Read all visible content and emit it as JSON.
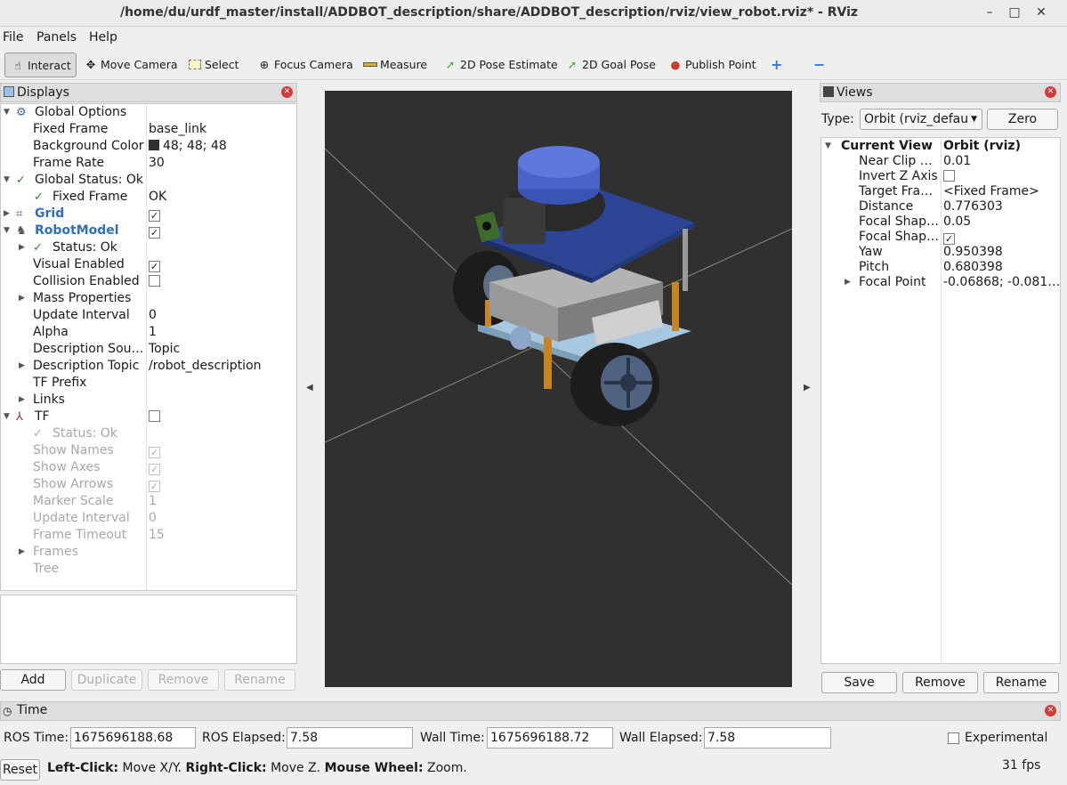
{
  "window": {
    "title": "/home/du/urdf_master/install/ADDBOT_description/share/ADDBOT_description/rviz/view_robot.rviz* - RViz",
    "minimize": "–",
    "maximize": "□",
    "close": "✕"
  },
  "menu": [
    {
      "label": "File",
      "accel": "F"
    },
    {
      "label": "Panels",
      "accel": "P"
    },
    {
      "label": "Help",
      "accel": "H"
    }
  ],
  "menu_labels": {
    "file": "File",
    "panels": "Panels",
    "help": "Help"
  },
  "toolbar": {
    "interact": "Interact",
    "move_camera": "Move Camera",
    "select": "Select",
    "focus_camera": "Focus Camera",
    "measure": "Measure",
    "pose_estimate": "2D Pose Estimate",
    "goal_pose": "2D Goal Pose",
    "publish_point": "Publish Point",
    "add_tool": "+",
    "remove_tool": "−"
  },
  "displays": {
    "title": "Displays",
    "global_options": {
      "label": "Global Options"
    },
    "fixed_frame": {
      "label": "Fixed Frame",
      "value": "base_link"
    },
    "background_color": {
      "label": "Background Color",
      "value": "48; 48; 48",
      "color": "#303030"
    },
    "frame_rate": {
      "label": "Frame Rate",
      "value": "30"
    },
    "global_status": {
      "label": "Global Status: Ok"
    },
    "gs_fixed_frame": {
      "label": "Fixed Frame",
      "value": "OK"
    },
    "grid": {
      "label": "Grid",
      "checked": true
    },
    "robot_model": {
      "label": "RobotModel",
      "checked": true
    },
    "rm_status": {
      "label": "Status: Ok"
    },
    "visual_enabled": {
      "label": "Visual Enabled",
      "checked": true
    },
    "collision_enabled": {
      "label": "Collision Enabled",
      "checked": false
    },
    "mass_properties": {
      "label": "Mass Properties"
    },
    "update_interval": {
      "label": "Update Interval",
      "value": "0"
    },
    "alpha": {
      "label": "Alpha",
      "value": "1"
    },
    "description_source": {
      "label": "Description Sou…",
      "value": "Topic"
    },
    "description_topic": {
      "label": "Description Topic",
      "value": "/robot_description"
    },
    "tf_prefix": {
      "label": "TF Prefix"
    },
    "links": {
      "label": "Links"
    },
    "tf": {
      "label": "TF",
      "checked": false
    },
    "tf_status": {
      "label": "Status: Ok"
    },
    "show_names": {
      "label": "Show Names",
      "checked": true
    },
    "show_axes": {
      "label": "Show Axes",
      "checked": true
    },
    "show_arrows": {
      "label": "Show Arrows",
      "checked": true
    },
    "marker_scale": {
      "label": "Marker Scale",
      "value": "1"
    },
    "tf_update_interval": {
      "label": "Update Interval",
      "value": "0"
    },
    "frame_timeout": {
      "label": "Frame Timeout",
      "value": "15"
    },
    "frames": {
      "label": "Frames"
    },
    "tree": {
      "label": "Tree"
    },
    "buttons": {
      "add": "Add",
      "duplicate": "Duplicate",
      "remove": "Remove",
      "rename": "Rename"
    }
  },
  "views": {
    "title": "Views",
    "type_label": "Type:",
    "type_value": "Orbit (rviz_defau",
    "zero": "Zero",
    "current_view": {
      "label": "Current View",
      "value": "Orbit (rviz)"
    },
    "near_clip": {
      "label": "Near Clip …",
      "value": "0.01"
    },
    "invert_z": {
      "label": "Invert Z Axis",
      "checked": false
    },
    "target_frame": {
      "label": "Target Fra…",
      "value": "<Fixed Frame>"
    },
    "distance": {
      "label": "Distance",
      "value": "0.776303"
    },
    "focal_shape_size": {
      "label": "Focal Shap…",
      "value": "0.05"
    },
    "focal_shape_fixed": {
      "label": "Focal Shap…",
      "checked": true
    },
    "yaw": {
      "label": "Yaw",
      "value": "0.950398"
    },
    "pitch": {
      "label": "Pitch",
      "value": "0.680398"
    },
    "focal_point": {
      "label": "Focal Point",
      "value": "-0.06868; -0.081…"
    },
    "buttons": {
      "save": "Save",
      "remove": "Remove",
      "rename": "Rename"
    }
  },
  "time": {
    "title": "Time",
    "ros_time_label": "ROS Time:",
    "ros_time": "1675696188.68",
    "ros_elapsed_label": "ROS Elapsed:",
    "ros_elapsed": "7.58",
    "wall_time_label": "Wall Time:",
    "wall_time": "1675696188.72",
    "wall_elapsed_label": "Wall Elapsed:",
    "wall_elapsed": "7.58",
    "experimental": "Experimental",
    "experimental_checked": false
  },
  "status": {
    "reset": "Reset",
    "hint_left_key": "Left-Click:",
    "hint_left": " Move X/Y. ",
    "hint_right_key": "Right-Click:",
    "hint_right": " Move Z. ",
    "hint_wheel_key": "Mouse Wheel:",
    "hint_wheel": " Zoom.",
    "fps": "31 fps"
  },
  "viewport": {
    "background": "#303030",
    "robot_top_color": "#2d4594",
    "lidar_color": "#4a63c8"
  }
}
